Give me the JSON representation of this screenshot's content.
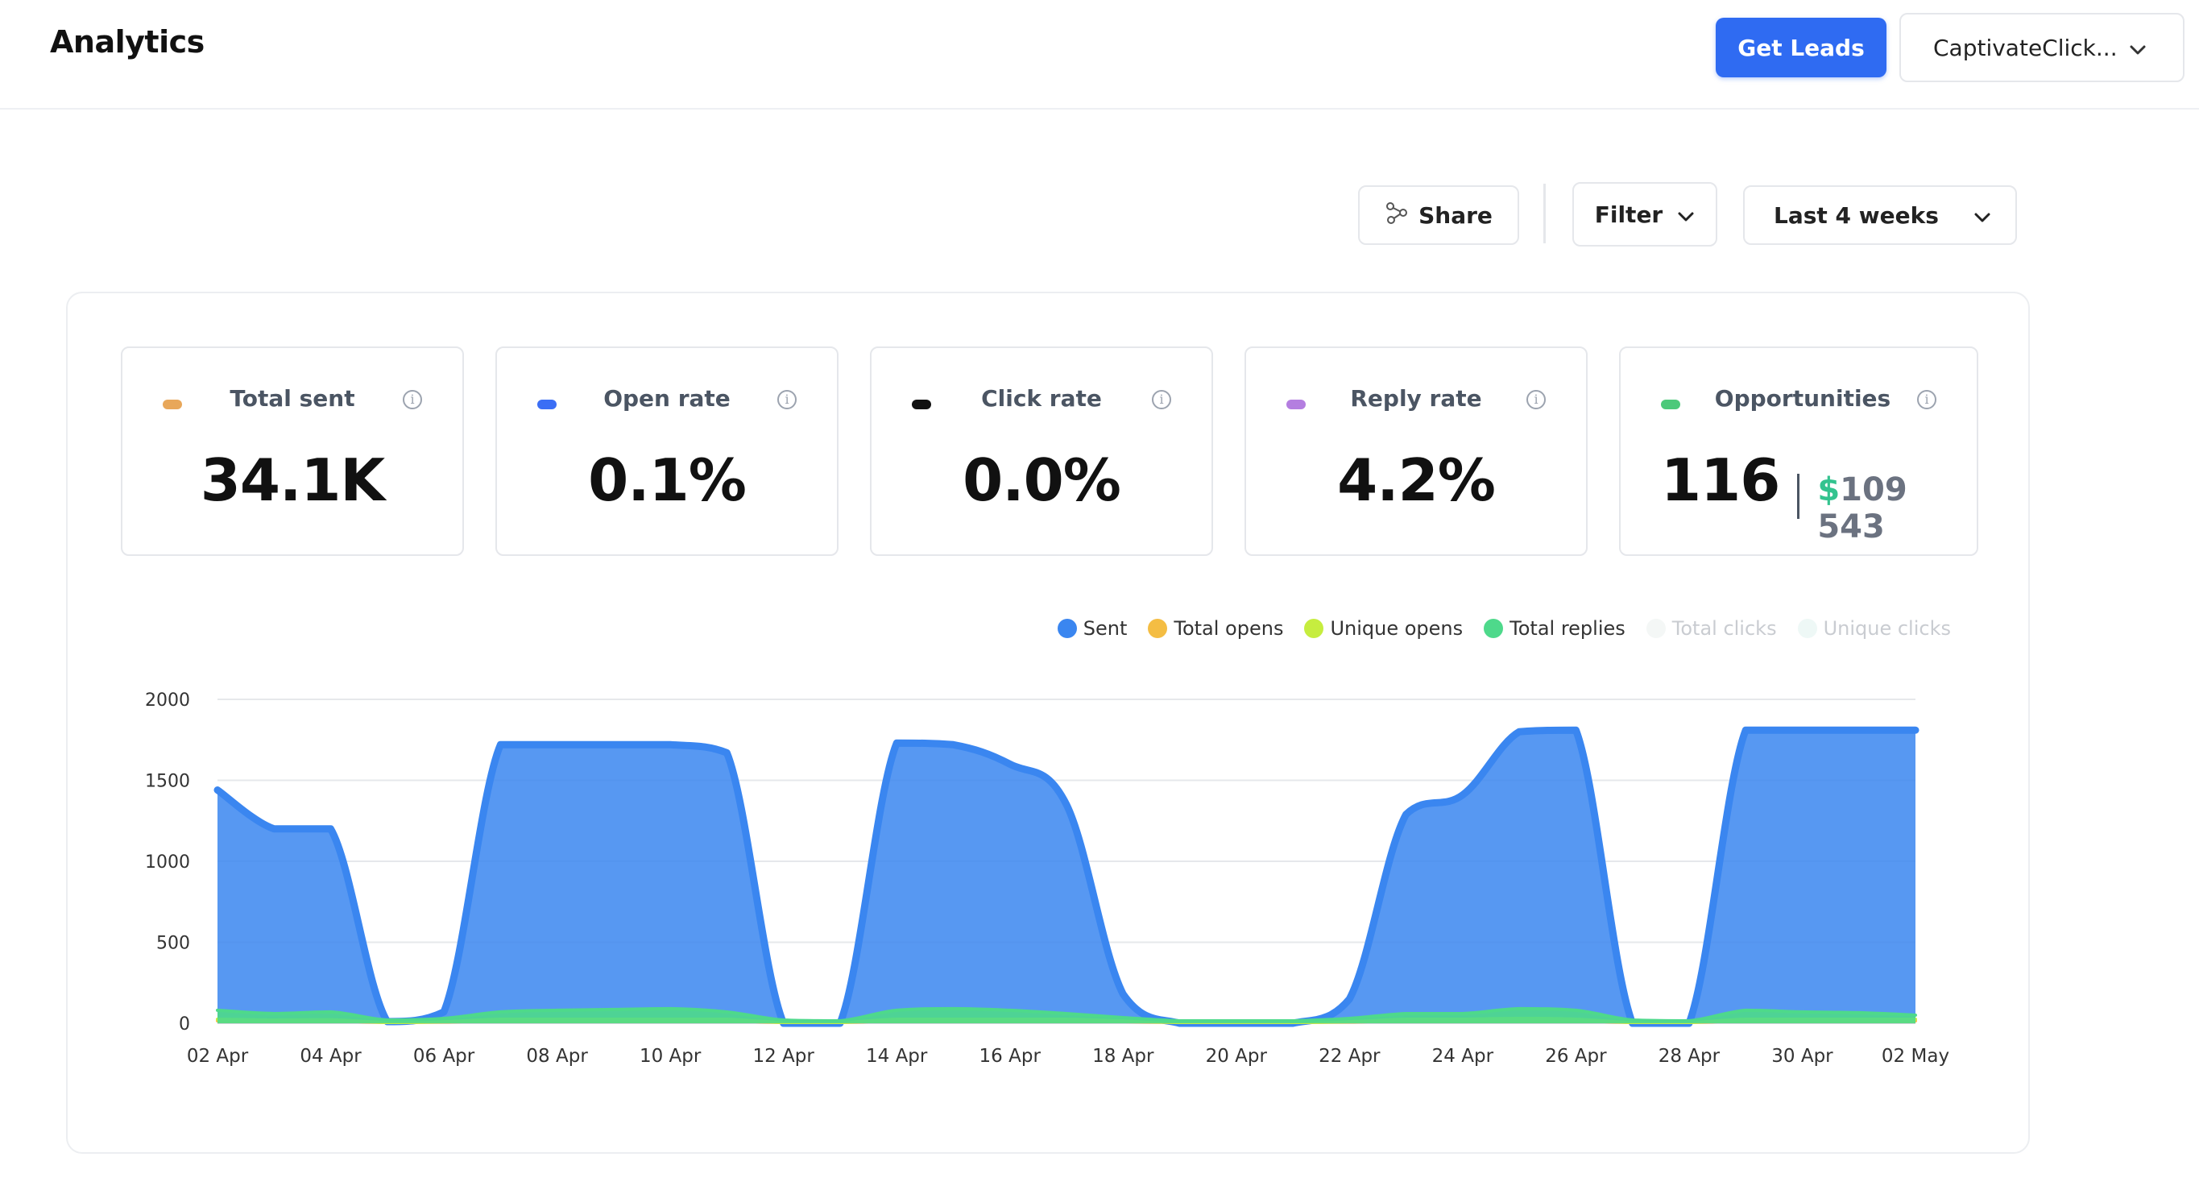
{
  "header": {
    "title": "Analytics",
    "get_leads_label": "Get Leads",
    "workspace_label": "CaptivateClick..."
  },
  "toolbar": {
    "share_label": "Share",
    "filter_label": "Filter",
    "range_label": "Last 4 weeks"
  },
  "stats": [
    {
      "label": "Total sent",
      "value": "34.1K",
      "color": "#e8a75a"
    },
    {
      "label": "Open rate",
      "value": "0.1%",
      "color": "#3b6ef5"
    },
    {
      "label": "Click rate",
      "value": "0.0%",
      "color": "#111111"
    },
    {
      "label": "Reply rate",
      "value": "4.2%",
      "color": "#b47ee0"
    },
    {
      "label": "Opportunities",
      "value": "116",
      "money_symbol": "$",
      "money_value": "109 543",
      "color": "#4cc97a"
    }
  ],
  "legend": [
    {
      "label": "Sent",
      "color": "#3a86f0",
      "active": true
    },
    {
      "label": "Total opens",
      "color": "#f4bd43",
      "active": true
    },
    {
      "label": "Unique opens",
      "color": "#c6ed3f",
      "active": true
    },
    {
      "label": "Total replies",
      "color": "#4ed98b",
      "active": true
    },
    {
      "label": "Total clicks",
      "color": "#f4f7f6",
      "active": false
    },
    {
      "label": "Unique clicks",
      "color": "#eef8f6",
      "active": false
    }
  ],
  "chart_data": {
    "type": "area",
    "y_ticks": [
      "2000",
      "1500",
      "1000",
      "500",
      "0"
    ],
    "ylim": [
      0,
      2000
    ],
    "x_tick_labels": [
      "02 Apr",
      "04 Apr",
      "06 Apr",
      "08 Apr",
      "10 Apr",
      "12 Apr",
      "14 Apr",
      "16 Apr",
      "18 Apr",
      "20 Apr",
      "22 Apr",
      "24 Apr",
      "26 Apr",
      "28 Apr",
      "30 Apr",
      "02 May"
    ],
    "x": [
      "02 Apr",
      "03 Apr",
      "04 Apr",
      "05 Apr",
      "06 Apr",
      "07 Apr",
      "08 Apr",
      "09 Apr",
      "10 Apr",
      "11 Apr",
      "12 Apr",
      "13 Apr",
      "14 Apr",
      "15 Apr",
      "16 Apr",
      "17 Apr",
      "18 Apr",
      "19 Apr",
      "20 Apr",
      "21 Apr",
      "22 Apr",
      "23 Apr",
      "24 Apr",
      "25 Apr",
      "26 Apr",
      "27 Apr",
      "28 Apr",
      "29 Apr",
      "30 Apr",
      "01 May",
      "02 May"
    ],
    "series": [
      {
        "name": "Sent",
        "color": "#3a86f0",
        "values": [
          1440,
          1200,
          1200,
          10,
          70,
          1720,
          1720,
          1720,
          1720,
          1670,
          0,
          0,
          1730,
          1720,
          1600,
          1350,
          180,
          0,
          0,
          0,
          150,
          1290,
          1410,
          1800,
          1810,
          0,
          0,
          1810,
          1810,
          1810,
          1810,
          1730
        ]
      },
      {
        "name": "Total opens",
        "color": "#f4bd43",
        "values": [
          15,
          15,
          15,
          5,
          8,
          15,
          15,
          15,
          15,
          15,
          5,
          5,
          15,
          15,
          15,
          15,
          10,
          5,
          5,
          5,
          8,
          15,
          15,
          15,
          15,
          5,
          5,
          15,
          15,
          15,
          15,
          15
        ]
      },
      {
        "name": "Unique opens",
        "color": "#c6ed3f",
        "values": [
          25,
          20,
          22,
          5,
          10,
          25,
          25,
          25,
          25,
          25,
          5,
          5,
          25,
          25,
          25,
          25,
          15,
          5,
          5,
          5,
          10,
          25,
          25,
          30,
          25,
          5,
          5,
          25,
          25,
          25,
          25,
          25
        ]
      },
      {
        "name": "Total replies",
        "color": "#4ed98b",
        "values": [
          80,
          60,
          70,
          20,
          30,
          70,
          80,
          85,
          90,
          70,
          20,
          15,
          80,
          90,
          80,
          60,
          35,
          15,
          15,
          15,
          30,
          60,
          60,
          90,
          80,
          20,
          15,
          80,
          70,
          65,
          50,
          70
        ]
      }
    ]
  }
}
